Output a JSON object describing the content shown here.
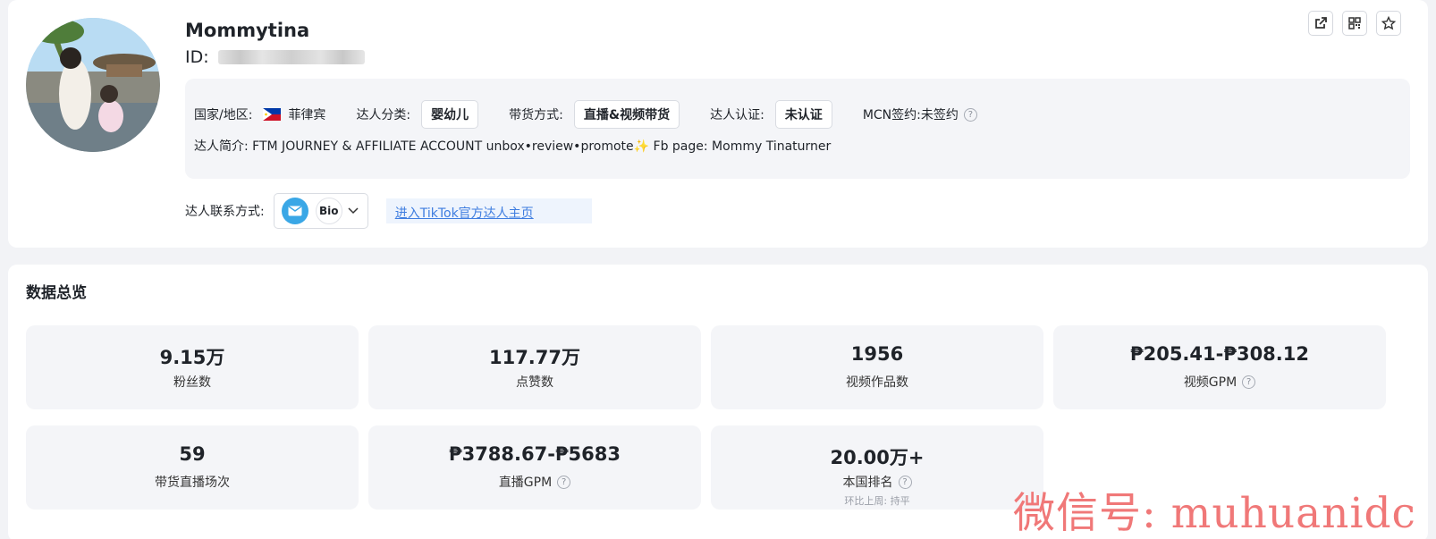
{
  "profile": {
    "name": "Mommytina",
    "id_label": "ID:",
    "country_label": "国家/地区:",
    "country_value": "菲律宾",
    "category_label": "达人分类:",
    "category_value": "婴幼儿",
    "sales_label": "带货方式:",
    "sales_value": "直播&视频带货",
    "cert_label": "达人认证:",
    "cert_value": "未认证",
    "mcn_label": "MCN签约:",
    "mcn_value": "未签约",
    "intro_label": "达人简介:",
    "intro_value": "FTM JOURNEY & AFFILIATE ACCOUNT unbox•review•promote✨ Fb page: Mommy Tinaturner",
    "contact_label": "达人联系方式:",
    "bio_label": "Bio",
    "tiktok_link": "进入TikTok官方达人主页"
  },
  "overview": {
    "title": "数据总览",
    "stats": [
      {
        "value": "9.15万",
        "label": "粉丝数"
      },
      {
        "value": "117.77万",
        "label": "点赞数"
      },
      {
        "value": "1956",
        "label": "视频作品数"
      },
      {
        "value": "₱205.41-₱308.12",
        "label": "视频GPM"
      },
      {
        "value": "59",
        "label": "带货直播场次"
      },
      {
        "value": "₱3788.67-₱5683",
        "label": "直播GPM"
      },
      {
        "value": "20.00万+",
        "label": "本国排名",
        "sub": "环比上周: 持平"
      }
    ]
  },
  "watermark": "微信号: muhuanidc"
}
